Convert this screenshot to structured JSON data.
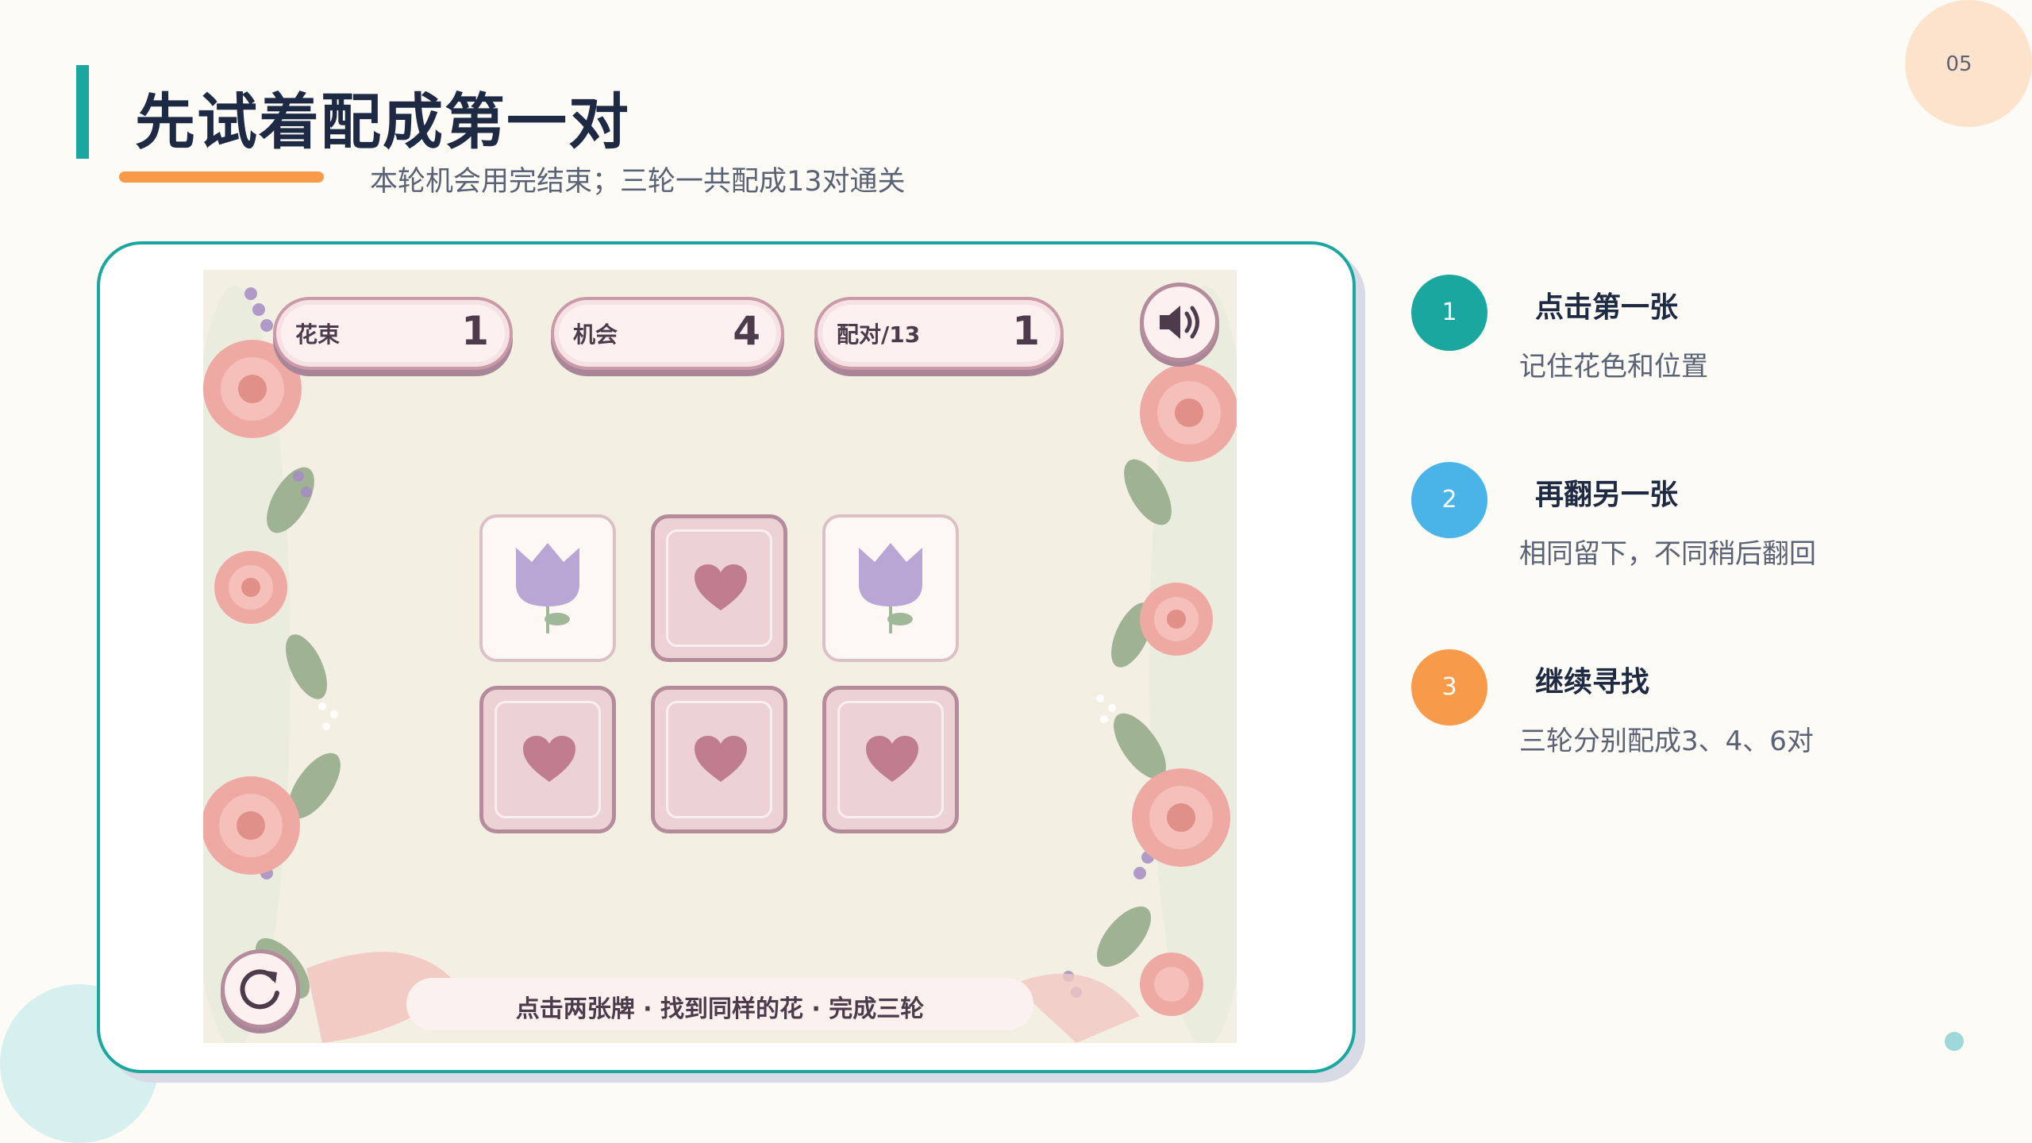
{
  "page": {
    "number": "05",
    "title": "先试着配成第一对",
    "subtitle": "本轮机会用完结束；三轮一共配成13对通关"
  },
  "game": {
    "stats": [
      {
        "label": "花束",
        "value": "1"
      },
      {
        "label": "机会",
        "value": "4"
      },
      {
        "label": "配对/13",
        "value": "1"
      }
    ],
    "sound_icon": "speaker-icon",
    "restart_icon": "restart-icon",
    "cards": [
      {
        "state": "face-up",
        "icon": "tulip-icon"
      },
      {
        "state": "face-down",
        "icon": "heart-icon"
      },
      {
        "state": "face-up",
        "icon": "tulip-icon"
      },
      {
        "state": "face-down",
        "icon": "heart-icon"
      },
      {
        "state": "face-down",
        "icon": "heart-icon"
      },
      {
        "state": "face-down",
        "icon": "heart-icon"
      }
    ],
    "hint": "点击两张牌 · 找到同样的花 · 完成三轮"
  },
  "steps": [
    {
      "number": "1",
      "title": "点击第一张",
      "desc": "记住花色和位置",
      "color": "#1aa79f"
    },
    {
      "number": "2",
      "title": "再翻另一张",
      "desc": "相同留下，不同稍后翻回",
      "color": "#4ab3e8"
    },
    {
      "number": "3",
      "title": "继续寻找",
      "desc": "三轮分别配成3、4、6对",
      "color": "#f79a4a"
    }
  ],
  "colors": {
    "accent_teal": "#1aa79f",
    "accent_orange": "#f79a4a",
    "card_back": "#ecd2d4",
    "heart": "#c07d8e",
    "tulip": "#b9a6d4"
  }
}
